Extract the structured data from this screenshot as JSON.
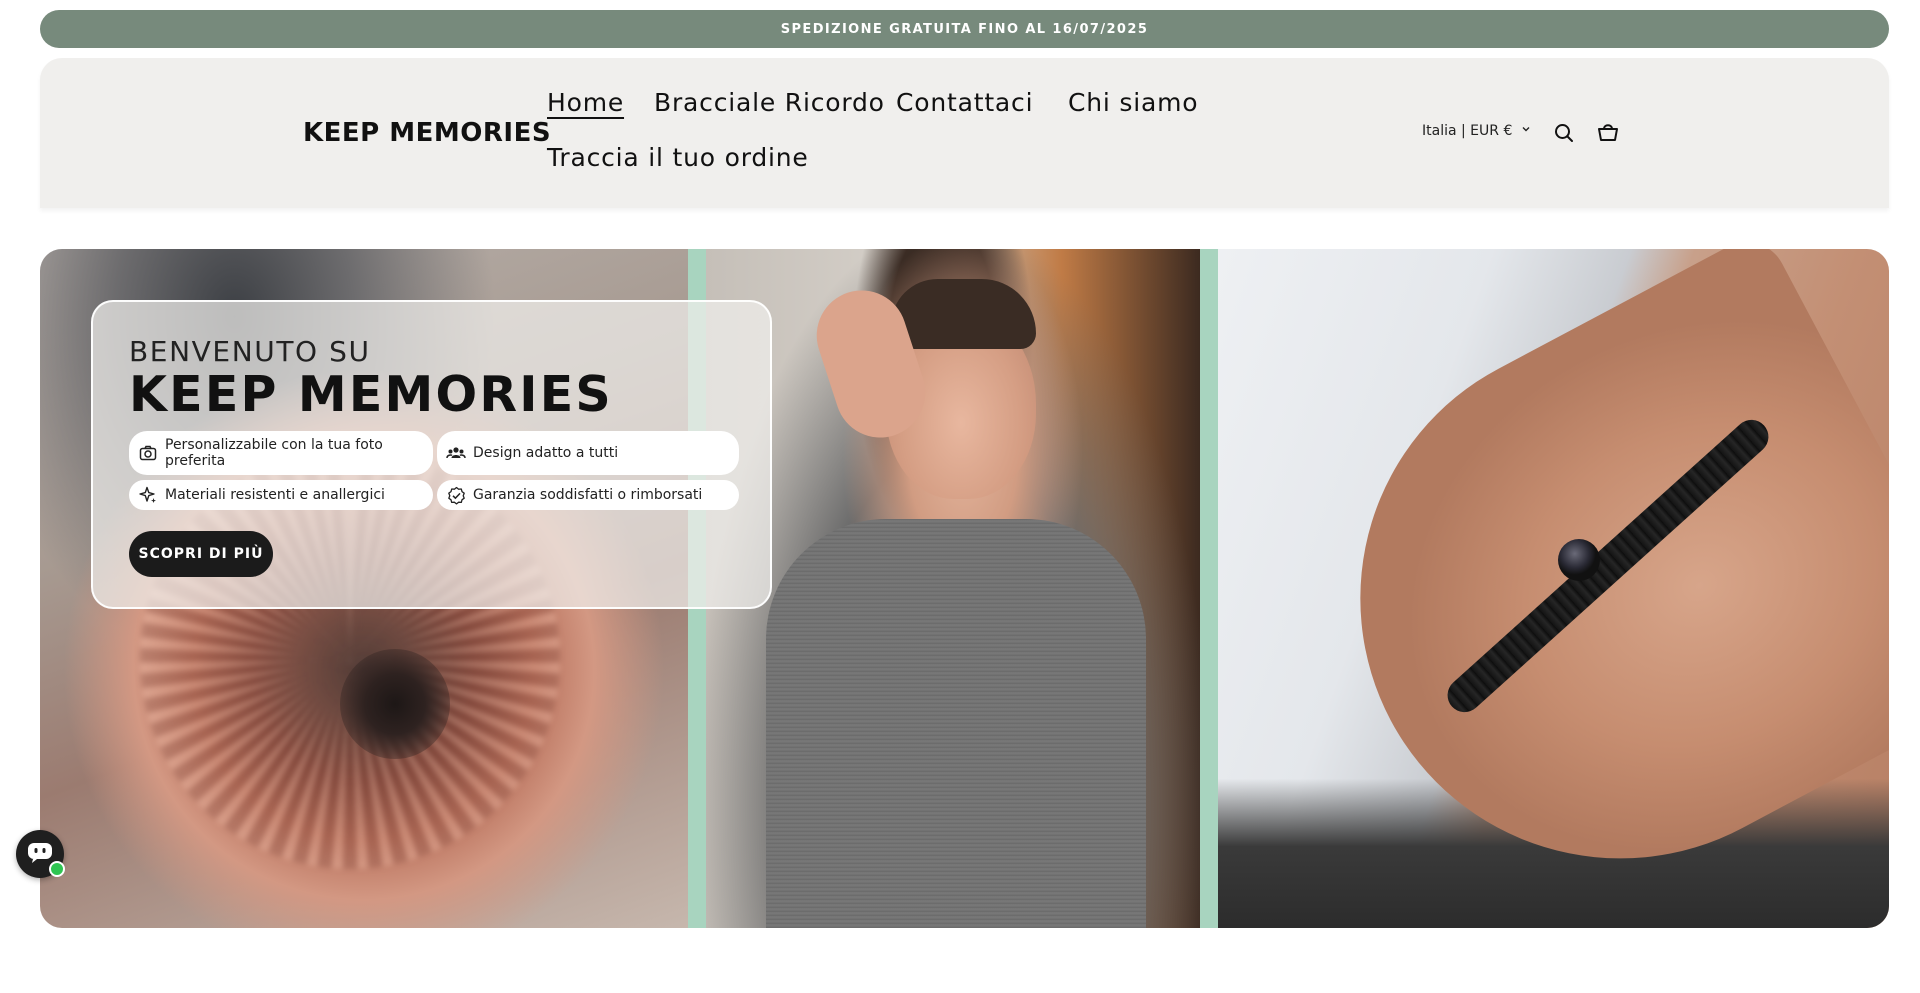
{
  "announcement": "SPEDIZIONE GRATUITA FINO AL 16/07/2025",
  "header": {
    "logo": "KEEP MEMORIES",
    "nav": [
      {
        "label": "Home",
        "active": true
      },
      {
        "label": "Bracciale Ricordo",
        "active": false
      },
      {
        "label": "Contattaci",
        "active": false
      },
      {
        "label": "Chi siamo",
        "active": false
      },
      {
        "label": "Traccia il tuo ordine",
        "active": false
      }
    ],
    "locale": "Italia | EUR €",
    "icons": [
      "chevron-down-icon",
      "search-icon",
      "cart-icon"
    ]
  },
  "hero": {
    "subtitle": "BENVENUTO SU",
    "title": "KEEP MEMORIES",
    "features": [
      {
        "label": "Personalizzabile con la tua foto preferita",
        "icon": "camera-icon"
      },
      {
        "label": "Design adatto a tutti",
        "icon": "group-icon"
      },
      {
        "label": "Materiali resistenti e anallergici",
        "icon": "sparkle-icon"
      },
      {
        "label": "Garanzia soddisfatti o rimborsati",
        "icon": "badge-check-icon"
      }
    ],
    "cta": "SCOPRI DI PIÙ",
    "images": [
      "dog-photo",
      "man-photo",
      "bracelet-wrist-photo"
    ]
  },
  "chat_widget": {
    "icon": "chat-bot-icon",
    "status": "online"
  },
  "colors": {
    "announcement_bg": "#778a7c",
    "header_bg": "#f0efed",
    "accent_strip": "#a8d4bf",
    "cta_bg": "#1b1b1b"
  }
}
